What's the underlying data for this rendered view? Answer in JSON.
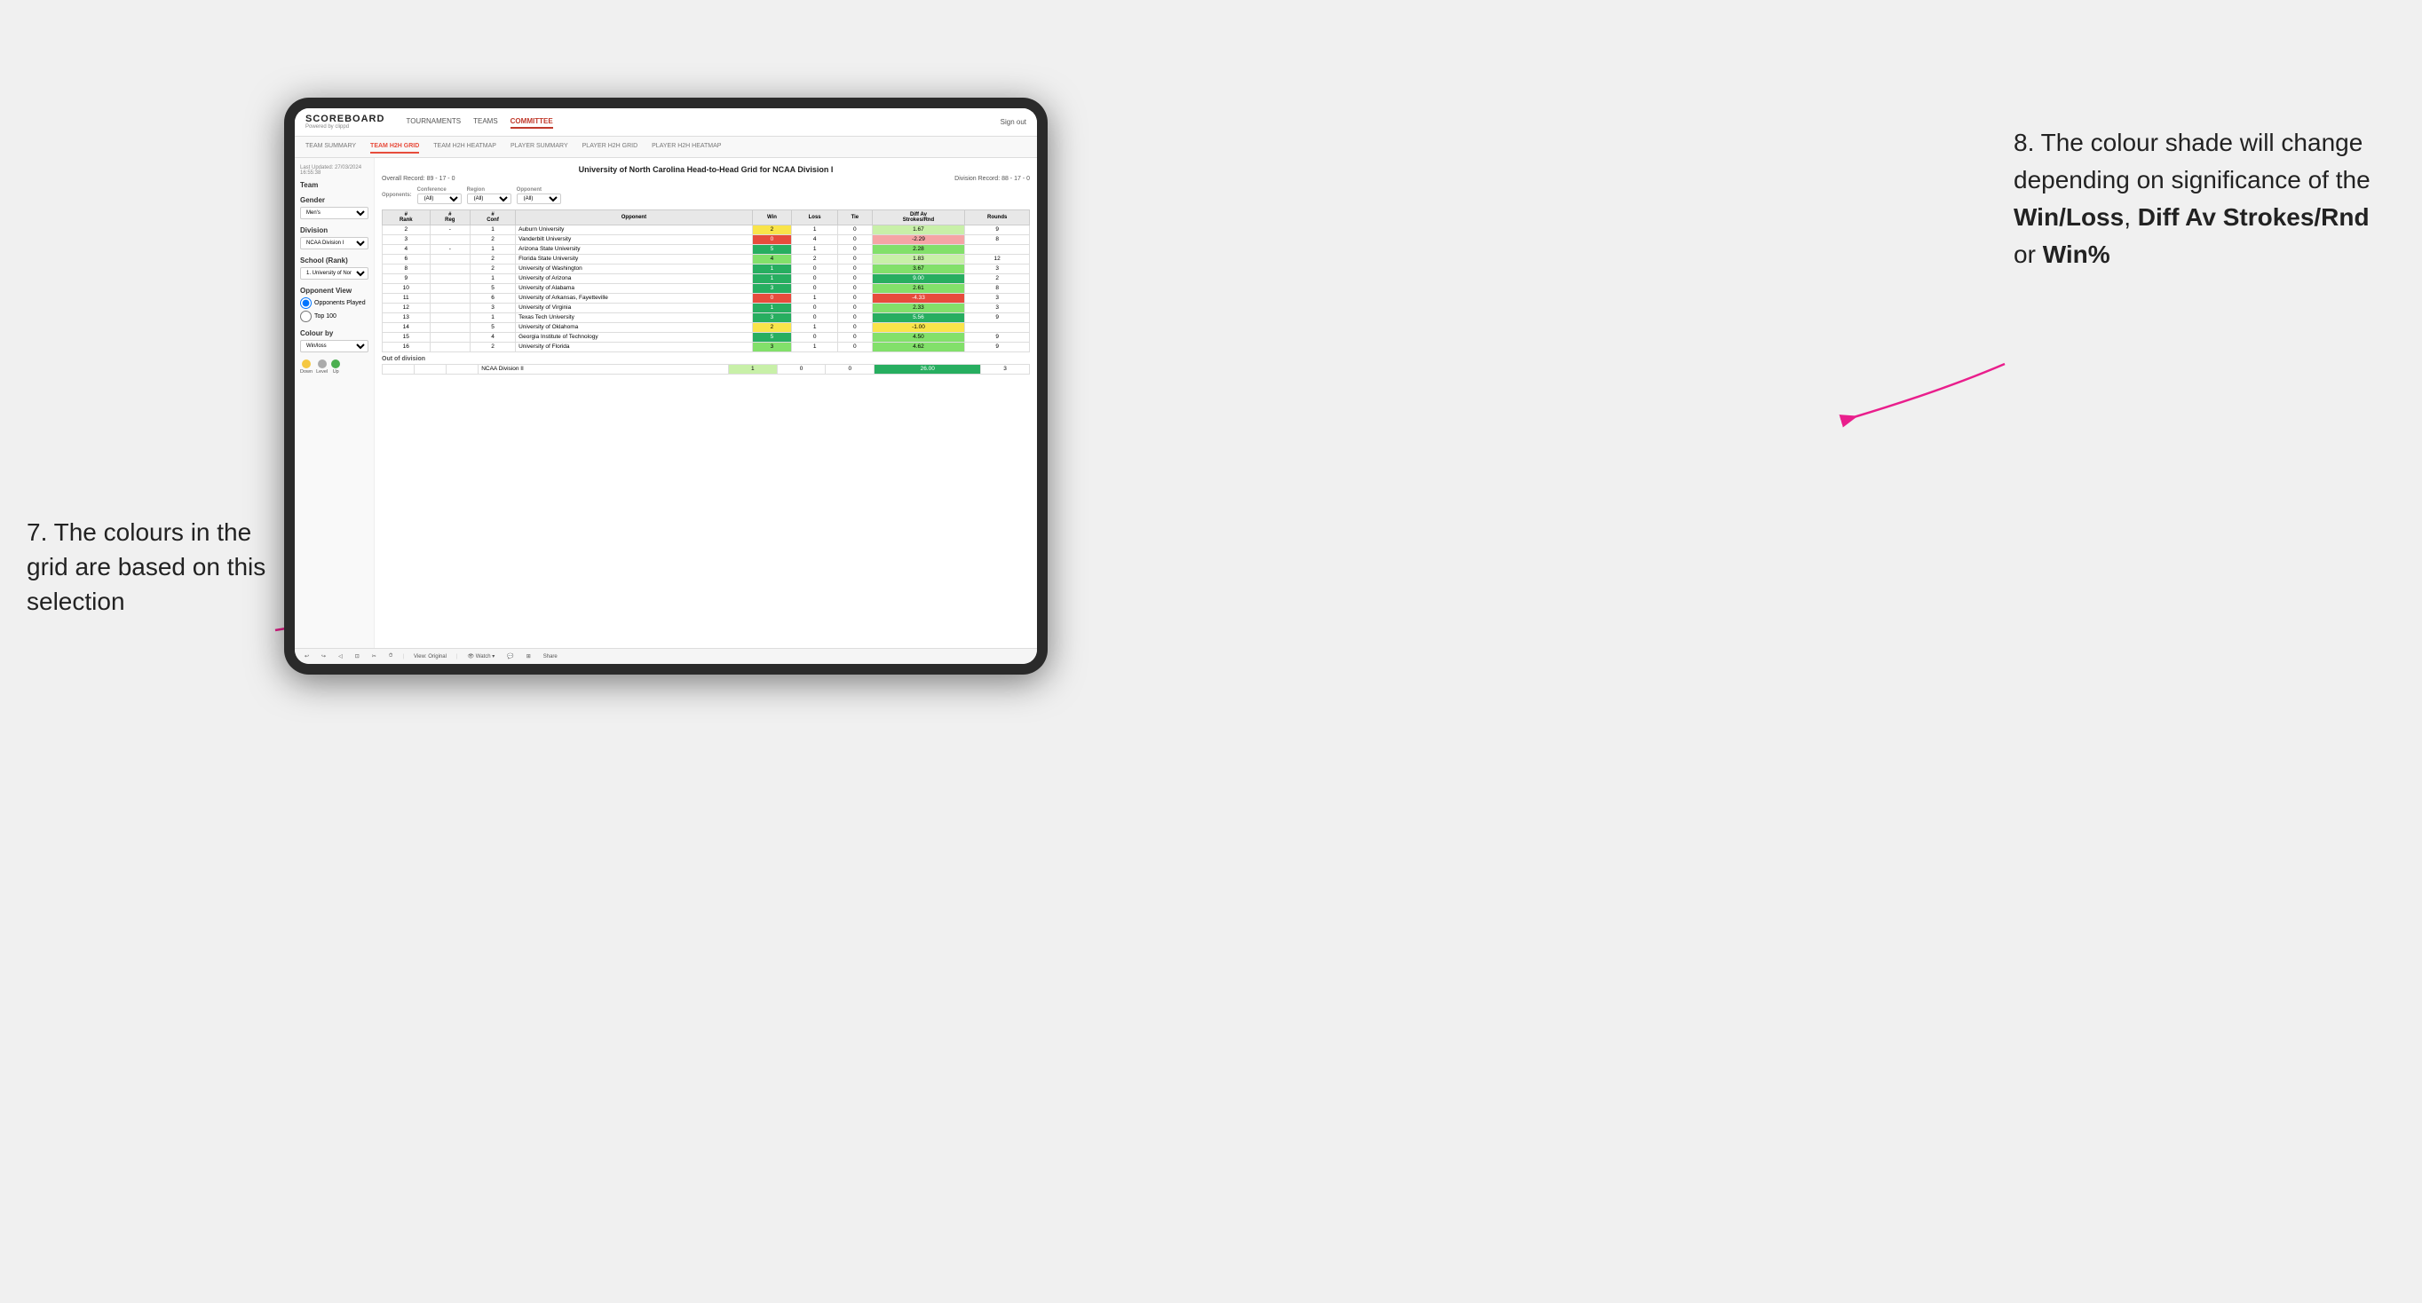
{
  "annotations": {
    "left": "7. The colours in the grid are based on this selection",
    "right_prefix": "8. The colour shade will change depending on significance of the ",
    "right_bold1": "Win/Loss",
    "right_comma": ", ",
    "right_bold2": "Diff Av Strokes/Rnd",
    "right_or": " or ",
    "right_bold3": "Win%"
  },
  "nav": {
    "logo": "SCOREBOARD",
    "logo_sub": "Powered by clippd",
    "links": [
      "TOURNAMENTS",
      "TEAMS",
      "COMMITTEE"
    ],
    "active": "COMMITTEE",
    "sign_out": "Sign out"
  },
  "sub_tabs": [
    "TEAM SUMMARY",
    "TEAM H2H GRID",
    "TEAM H2H HEATMAP",
    "PLAYER SUMMARY",
    "PLAYER H2H GRID",
    "PLAYER H2H HEATMAP"
  ],
  "sub_active": "TEAM H2H GRID",
  "sidebar": {
    "timestamp": "Last Updated: 27/03/2024 16:55:38",
    "team_label": "Team",
    "gender_label": "Gender",
    "gender_value": "Men's",
    "division_label": "Division",
    "division_value": "NCAA Division I",
    "school_label": "School (Rank)",
    "school_value": "1. University of Nort...",
    "opponent_view_label": "Opponent View",
    "radio1": "Opponents Played",
    "radio2": "Top 100",
    "colour_by_label": "Colour by",
    "colour_by_value": "Win/loss",
    "legend": [
      {
        "color": "#f5c842",
        "label": "Down"
      },
      {
        "color": "#aaaaaa",
        "label": "Level"
      },
      {
        "color": "#4caf50",
        "label": "Up"
      }
    ]
  },
  "grid": {
    "title": "University of North Carolina Head-to-Head Grid for NCAA Division I",
    "overall_record": "Overall Record: 89 - 17 - 0",
    "division_record": "Division Record: 88 - 17 - 0",
    "filters": {
      "opponents_label": "Opponents:",
      "opponents_value": "(All)",
      "conference_label": "Conference",
      "conference_value": "(All)",
      "region_label": "Region",
      "region_value": "(All)",
      "opponent_label": "Opponent",
      "opponent_value": "(All)"
    },
    "columns": [
      "#\nRank",
      "#\nReg",
      "#\nConf",
      "Opponent",
      "Win",
      "Loss",
      "Tie",
      "Diff Av\nStrokes/Rnd",
      "Rounds"
    ],
    "rows": [
      {
        "rank": "2",
        "reg": "-",
        "conf": "1",
        "opponent": "Auburn University",
        "win": "2",
        "loss": "1",
        "tie": "0",
        "diff": "1.67",
        "rounds": "9",
        "win_color": "bg-yellow",
        "diff_color": "bg-green-light"
      },
      {
        "rank": "3",
        "reg": "",
        "conf": "2",
        "opponent": "Vanderbilt University",
        "win": "0",
        "loss": "4",
        "tie": "0",
        "diff": "-2.29",
        "rounds": "8",
        "win_color": "bg-red",
        "diff_color": "bg-red-light"
      },
      {
        "rank": "4",
        "reg": "-",
        "conf": "1",
        "opponent": "Arizona State University",
        "win": "5",
        "loss": "1",
        "tie": "0",
        "diff": "2.28",
        "rounds": "",
        "win_color": "bg-green-dark",
        "diff_color": "bg-green-med"
      },
      {
        "rank": "6",
        "reg": "",
        "conf": "2",
        "opponent": "Florida State University",
        "win": "4",
        "loss": "2",
        "tie": "0",
        "diff": "1.83",
        "rounds": "12",
        "win_color": "bg-green-med",
        "diff_color": "bg-green-light"
      },
      {
        "rank": "8",
        "reg": "",
        "conf": "2",
        "opponent": "University of Washington",
        "win": "1",
        "loss": "0",
        "tie": "0",
        "diff": "3.67",
        "rounds": "3",
        "win_color": "bg-green-dark",
        "diff_color": "bg-green-med"
      },
      {
        "rank": "9",
        "reg": "",
        "conf": "1",
        "opponent": "University of Arizona",
        "win": "1",
        "loss": "0",
        "tie": "0",
        "diff": "9.00",
        "rounds": "2",
        "win_color": "bg-green-dark",
        "diff_color": "bg-green-dark"
      },
      {
        "rank": "10",
        "reg": "",
        "conf": "5",
        "opponent": "University of Alabama",
        "win": "3",
        "loss": "0",
        "tie": "0",
        "diff": "2.61",
        "rounds": "8",
        "win_color": "bg-green-dark",
        "diff_color": "bg-green-med"
      },
      {
        "rank": "11",
        "reg": "",
        "conf": "6",
        "opponent": "University of Arkansas, Fayetteville",
        "win": "0",
        "loss": "1",
        "tie": "0",
        "diff": "-4.33",
        "rounds": "3",
        "win_color": "bg-red",
        "diff_color": "bg-red"
      },
      {
        "rank": "12",
        "reg": "",
        "conf": "3",
        "opponent": "University of Virginia",
        "win": "1",
        "loss": "0",
        "tie": "0",
        "diff": "2.33",
        "rounds": "3",
        "win_color": "bg-green-dark",
        "diff_color": "bg-green-med"
      },
      {
        "rank": "13",
        "reg": "",
        "conf": "1",
        "opponent": "Texas Tech University",
        "win": "3",
        "loss": "0",
        "tie": "0",
        "diff": "5.56",
        "rounds": "9",
        "win_color": "bg-green-dark",
        "diff_color": "bg-green-dark"
      },
      {
        "rank": "14",
        "reg": "",
        "conf": "5",
        "opponent": "University of Oklahoma",
        "win": "2",
        "loss": "1",
        "tie": "0",
        "diff": "-1.00",
        "rounds": "",
        "win_color": "bg-yellow",
        "diff_color": "bg-yellow"
      },
      {
        "rank": "15",
        "reg": "",
        "conf": "4",
        "opponent": "Georgia Institute of Technology",
        "win": "5",
        "loss": "0",
        "tie": "0",
        "diff": "4.50",
        "rounds": "9",
        "win_color": "bg-green-dark",
        "diff_color": "bg-green-med"
      },
      {
        "rank": "16",
        "reg": "",
        "conf": "2",
        "opponent": "University of Florida",
        "win": "3",
        "loss": "1",
        "tie": "0",
        "diff": "4.62",
        "rounds": "9",
        "win_color": "bg-green-med",
        "diff_color": "bg-green-med"
      }
    ],
    "out_of_division_label": "Out of division",
    "out_of_division_rows": [
      {
        "opponent": "NCAA Division II",
        "win": "1",
        "loss": "0",
        "tie": "0",
        "diff": "26.00",
        "rounds": "3",
        "diff_color": "bg-green-dark"
      }
    ]
  },
  "toolbar": {
    "view_label": "View: Original",
    "watch_label": "Watch ▾",
    "share_label": "Share"
  }
}
